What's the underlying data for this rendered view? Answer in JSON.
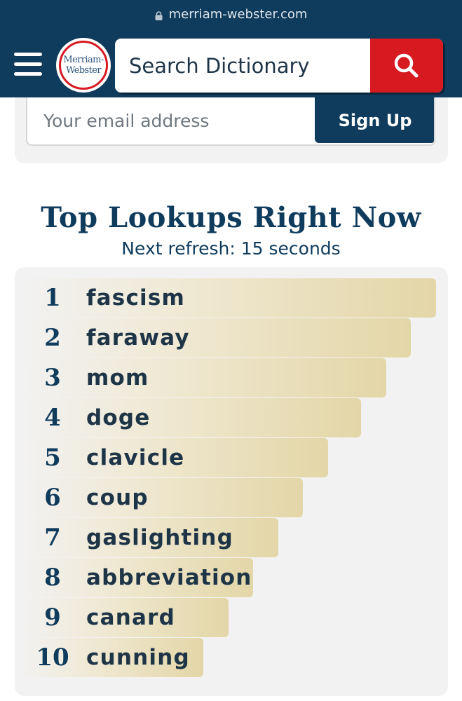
{
  "browser": {
    "url": "merriam-webster.com"
  },
  "header": {
    "logo_line1": "Merriam-",
    "logo_line2": "Webster",
    "search_placeholder": "Search Dictionary"
  },
  "newsletter": {
    "email_placeholder": "Your email address",
    "signup_label": "Sign Up"
  },
  "top_lookups": {
    "title": "Top Lookups Right Now",
    "refresh_text": "Next refresh: 15 seconds",
    "items": [
      {
        "rank": "1",
        "word": "fascism",
        "level": 1.0
      },
      {
        "rank": "2",
        "word": "faraway",
        "level": 0.94
      },
      {
        "rank": "3",
        "word": "mom",
        "level": 0.88
      },
      {
        "rank": "4",
        "word": "doge",
        "level": 0.82
      },
      {
        "rank": "5",
        "word": "clavicle",
        "level": 0.74
      },
      {
        "rank": "6",
        "word": "coup",
        "level": 0.68
      },
      {
        "rank": "7",
        "word": "gaslighting",
        "level": 0.62
      },
      {
        "rank": "8",
        "word": "abbreviation",
        "level": 0.56
      },
      {
        "rank": "9",
        "word": "canard",
        "level": 0.5
      },
      {
        "rank": "10",
        "word": "cunning",
        "level": 0.44
      }
    ]
  },
  "colors": {
    "navy": "#0f3b5c",
    "red": "#d71920",
    "bar_gold": "#e3d6a7",
    "panel_gray": "#f2f2f2"
  },
  "icons": {
    "lock": "lock-icon",
    "menu": "hamburger-menu-icon",
    "search": "search-icon"
  }
}
